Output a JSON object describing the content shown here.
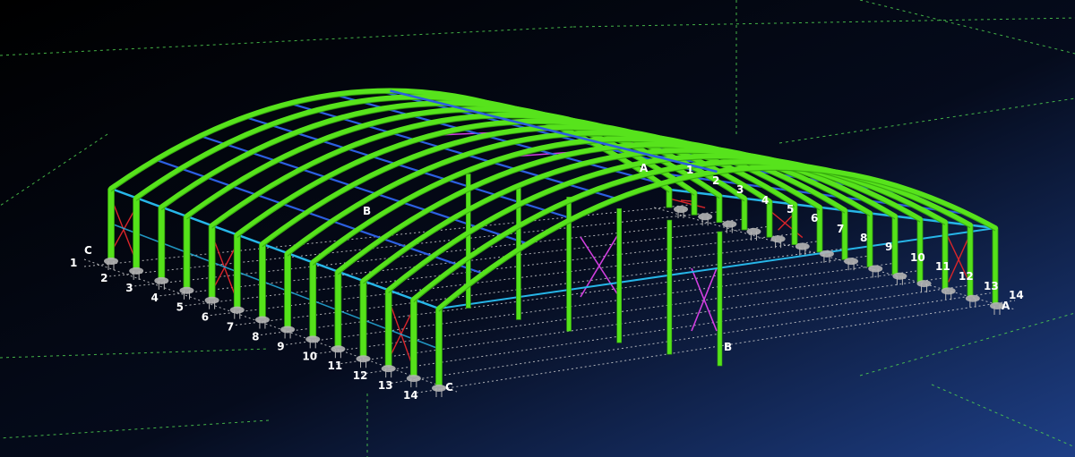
{
  "view": {
    "background_top": "#000000",
    "background_bottom": "#1e3f86",
    "colors": {
      "column": "#55e21a",
      "column_dark": "#2e9a0c",
      "rafter": "#57e31c",
      "purlin": "#2c5fe0",
      "eave_strut": "#27b6e8",
      "bracing_red": "#d9252a",
      "bracing_magenta": "#d23ee0",
      "gridline": "#d8d8d8",
      "axis_guide": "#4fd150",
      "base_plate": "#b4b4b4",
      "label": "#ffffff"
    }
  },
  "labels": {
    "front_left_axis_c": "C",
    "front_left_numbers": [
      "1",
      "2",
      "3",
      "4",
      "5",
      "6",
      "7",
      "8",
      "9",
      "10",
      "11",
      "12",
      "13",
      "14"
    ],
    "front_right_end_c": "C",
    "back_right_numbers": [
      "1",
      "2",
      "3",
      "4",
      "5",
      "6",
      "7",
      "8",
      "9",
      "10",
      "11",
      "12",
      "13",
      "14"
    ],
    "back_right_end_a": "A",
    "top_ridge_a": "A",
    "left_mid_b": "B",
    "front_mid_b": "B"
  }
}
